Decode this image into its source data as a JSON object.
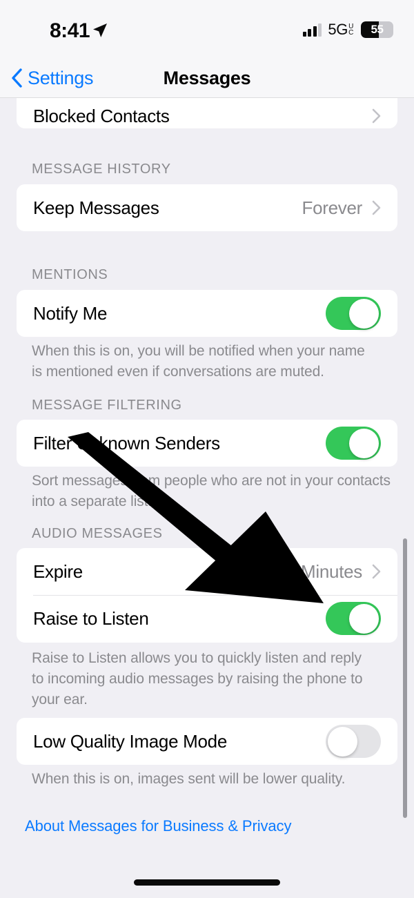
{
  "status_bar": {
    "time": "8:41",
    "location_icon": "location-arrow-icon",
    "signal_icon": "cellular-bars-icon",
    "network": "5G",
    "network_sub_top": "U",
    "network_sub_bottom": "C",
    "battery_percent": "55",
    "battery_level": 55
  },
  "nav": {
    "back_label": "Settings",
    "back_icon": "chevron-left-icon",
    "title": "Messages"
  },
  "rows": {
    "blocked_contacts": {
      "label": "Blocked Contacts",
      "accessory": "chevron-right-icon"
    },
    "keep_messages": {
      "label": "Keep Messages",
      "value": "Forever",
      "accessory": "chevron-right-icon"
    },
    "notify_me": {
      "label": "Notify Me",
      "toggle": "on"
    },
    "filter_unknown": {
      "label": "Filter Unknown Senders",
      "toggle": "on"
    },
    "expire": {
      "label": "Expire",
      "value": "Minutes",
      "accessory": "chevron-right-icon"
    },
    "raise_to_listen": {
      "label": "Raise to Listen",
      "toggle": "on"
    },
    "low_quality": {
      "label": "Low Quality Image Mode",
      "toggle": "off"
    }
  },
  "group_headers": {
    "message_history": "MESSAGE HISTORY",
    "mentions": "MENTIONS",
    "message_filtering": "MESSAGE FILTERING",
    "audio_messages": "AUDIO MESSAGES"
  },
  "footnotes": {
    "mentions": "When this is on, you will be notified when your name is mentioned even if conversations are muted.",
    "filtering": "Sort messages from people who are not in your contacts into a separate list.",
    "raise_to_listen": "Raise to Listen allows you to quickly listen and reply to incoming audio messages by raising the phone to your ear.",
    "low_quality": "When this is on, images sent will be lower quality."
  },
  "footer_link": "About Messages for Business & Privacy",
  "annotation": {
    "type": "arrow",
    "color": "#000000",
    "points_to": "raise-to-listen-toggle"
  },
  "colors": {
    "background": "#F0EFF4",
    "card": "#FFFFFF",
    "accent_blue": "#0A7AFF",
    "toggle_on_green": "#34C759",
    "toggle_off_gray": "#E4E4E7",
    "secondary_text": "#8A8A8E"
  }
}
